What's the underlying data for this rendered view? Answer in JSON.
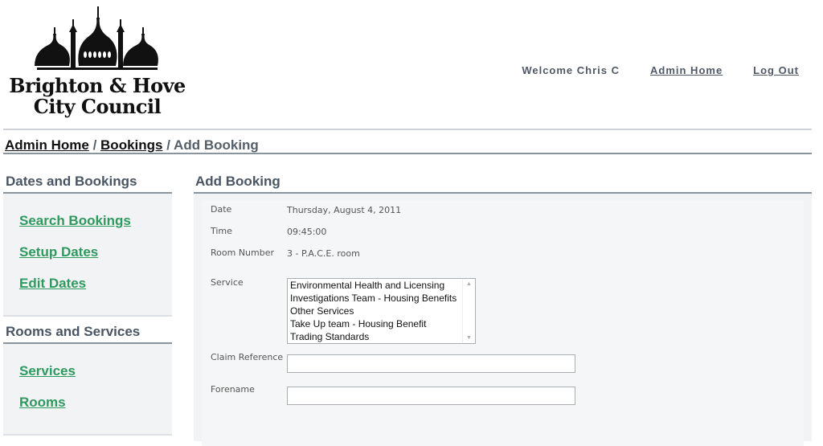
{
  "header": {
    "logo_line1": "Brighton & Hove",
    "logo_line2": "City Council",
    "welcome": "Welcome Chris C",
    "admin_home": "Admin Home",
    "log_out": "Log Out"
  },
  "breadcrumb": {
    "items": [
      "Admin Home",
      "Bookings"
    ],
    "separator": "/",
    "current": "Add Booking"
  },
  "sidebar": {
    "sections": [
      {
        "title": "Dates and Bookings",
        "links": [
          "Search Bookings",
          "Setup Dates",
          "Edit Dates"
        ]
      },
      {
        "title": "Rooms and Services",
        "links": [
          "Services",
          "Rooms"
        ]
      }
    ]
  },
  "main": {
    "title": "Add Booking",
    "fields": {
      "date": {
        "label": "Date",
        "value": "Thursday, August 4, 2011"
      },
      "time": {
        "label": "Time",
        "value": "09:45:00"
      },
      "room": {
        "label": "Room Number",
        "value": "3 - P.A.C.E. room"
      },
      "service": {
        "label": "Service",
        "options": [
          "Environmental Health and Licensing",
          "Investigations Team - Housing Benefits",
          "Other Services",
          "Take Up team - Housing Benefit",
          "Trading Standards"
        ]
      },
      "claim_reference": {
        "label": "Claim Reference",
        "value": ""
      },
      "forename": {
        "label": "Forename",
        "value": ""
      }
    }
  },
  "colors": {
    "link_green": "#2e9a5d",
    "heading": "#4a5563",
    "rule": "#8a949c",
    "panel_bg": "#f1f3f5"
  }
}
